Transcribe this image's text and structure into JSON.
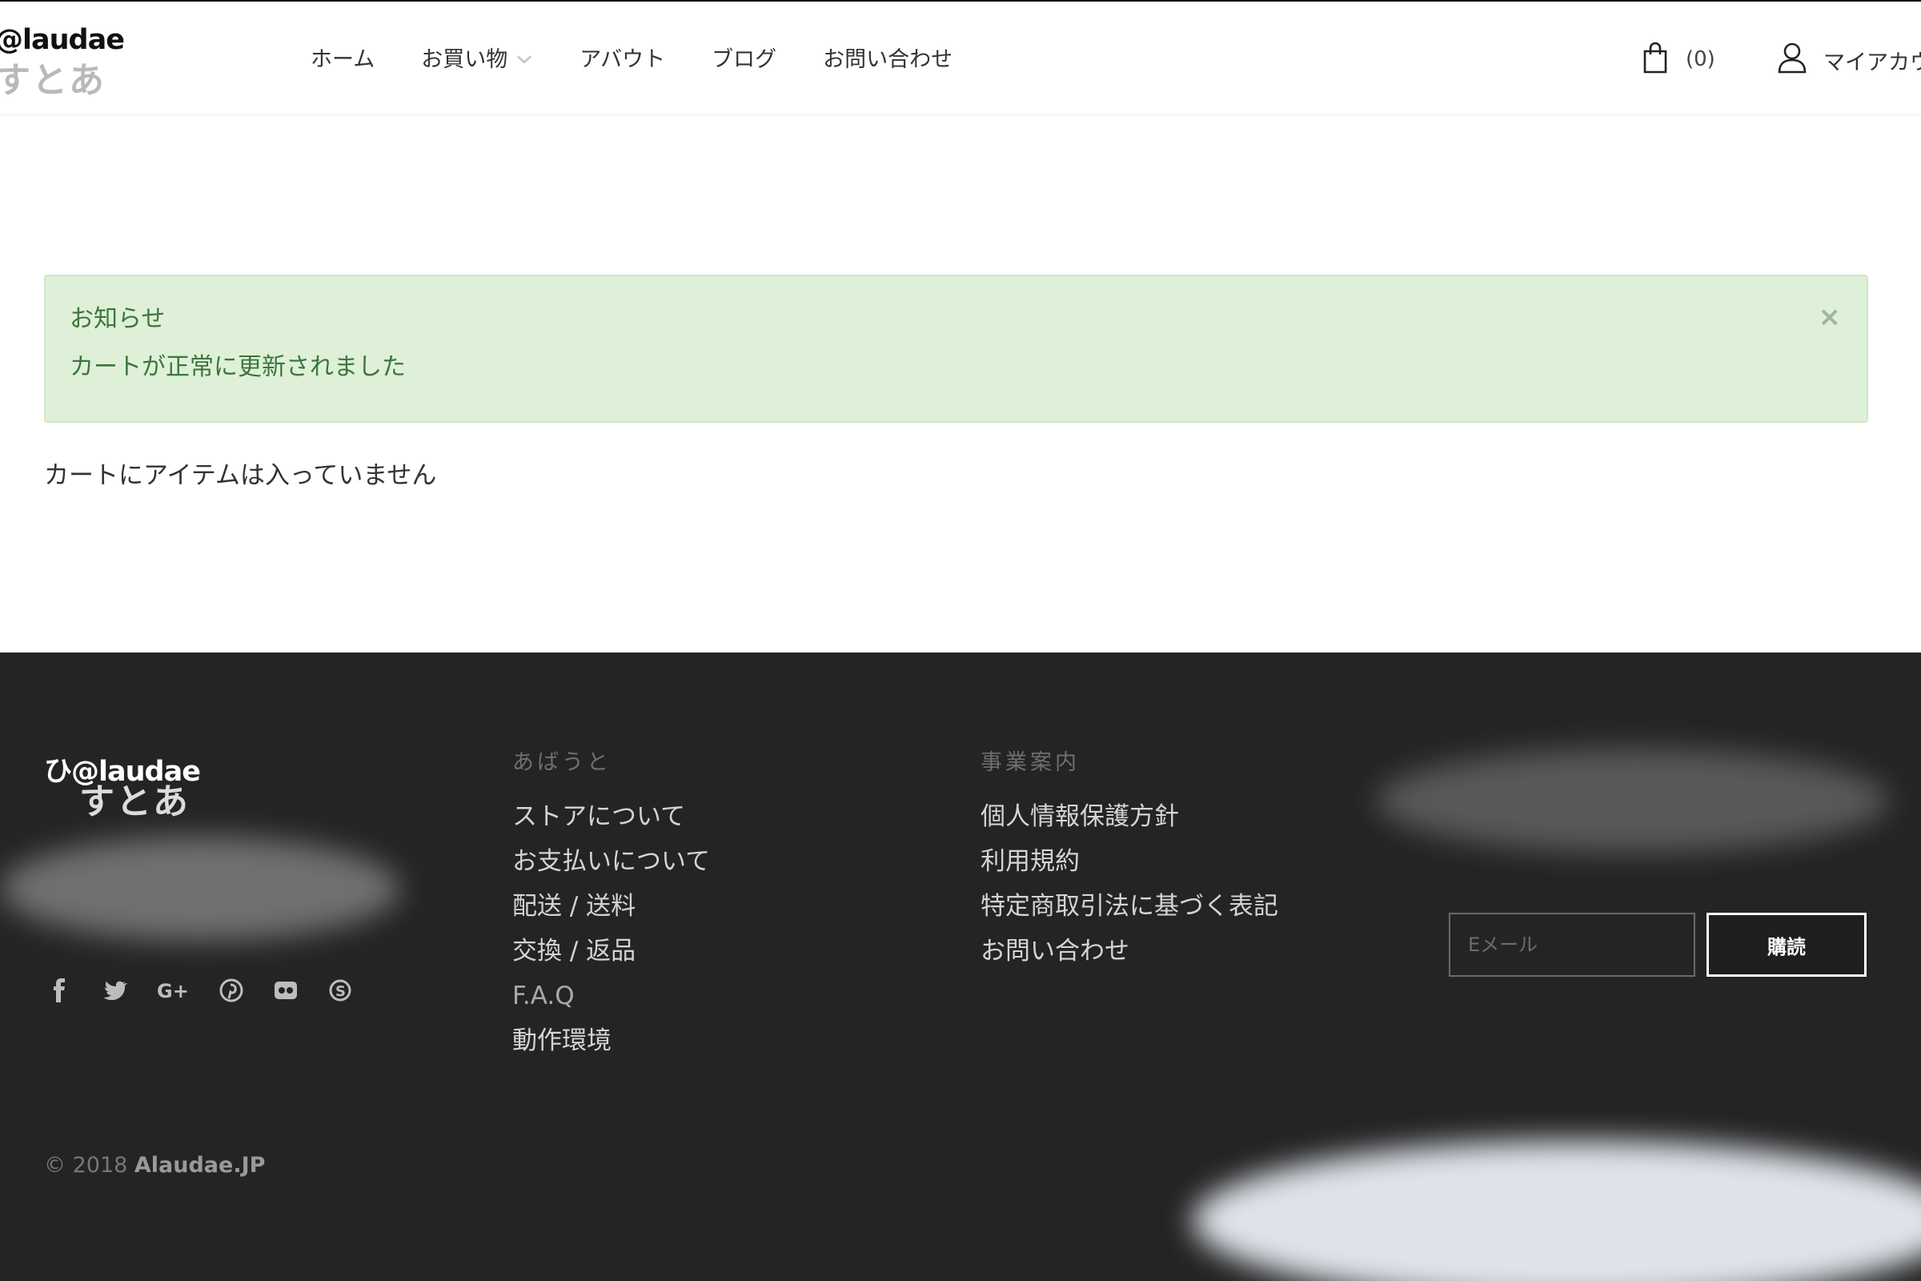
{
  "header": {
    "logo_line1": "@laudae",
    "logo_line2": "すとあ",
    "nav": [
      "ホーム",
      "お買い物",
      "アバウト",
      "ブログ",
      "お問い合わせ"
    ],
    "cart_count": "(0)",
    "account_label": "マイアカウ"
  },
  "notice": {
    "title": "お知らせ",
    "message": "カートが正常に更新されました",
    "close": "×"
  },
  "main": {
    "empty_message": "カートにアイテムは入っていません"
  },
  "footer": {
    "logo_line1": "ひ@laudae",
    "logo_line2": "すとあ",
    "col1": {
      "heading": "あばうと",
      "links": [
        "ストアについて",
        "お支払いについて",
        "配送 / 送料",
        "交換 / 返品",
        "F.A.Q",
        "動作環境"
      ]
    },
    "col2": {
      "heading": "事業案内",
      "links": [
        "個人情報保護方針",
        "利用規約",
        "特定商取引法に基づく表記",
        "お問い合わせ"
      ]
    },
    "subscribe": {
      "placeholder": "Eメール",
      "button": "購読"
    },
    "social_icons": [
      "facebook-icon",
      "twitter-icon",
      "google-plus-icon",
      "pinterest-icon",
      "flickr-icon",
      "skype-icon"
    ],
    "copyright_prefix": "© 2018",
    "copyright_brand": "Alaudae.JP"
  }
}
